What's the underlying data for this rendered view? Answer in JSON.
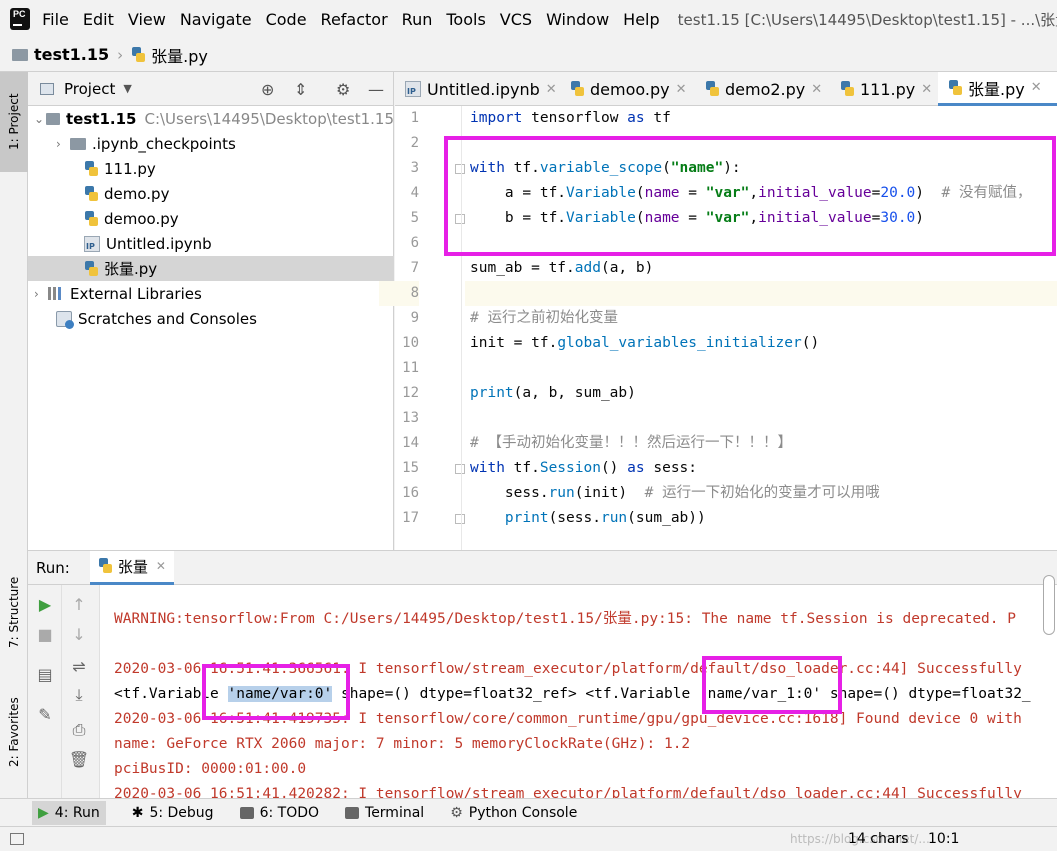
{
  "menu": {
    "items": [
      "File",
      "Edit",
      "View",
      "Navigate",
      "Code",
      "Refactor",
      "Run",
      "Tools",
      "VCS",
      "Window",
      "Help"
    ],
    "window_title": "test1.15 [C:\\Users\\14495\\Desktop\\test1.15] - ...\\张量.py"
  },
  "breadcrumb": {
    "project": "test1.15",
    "file": "张量.py"
  },
  "side_tabs": {
    "project": "1: Project",
    "structure": "7: Structure",
    "favorites": "2: Favorites"
  },
  "project_panel": {
    "title": "Project",
    "tree": [
      {
        "label": "test1.15",
        "path": "C:\\Users\\14495\\Desktop\\test1.15",
        "type": "root"
      },
      {
        "label": ".ipynb_checkpoints",
        "type": "folder"
      },
      {
        "label": "111.py",
        "type": "py"
      },
      {
        "label": "demo.py",
        "type": "py"
      },
      {
        "label": "demoo.py",
        "type": "py"
      },
      {
        "label": "Untitled.ipynb",
        "type": "ipynb"
      },
      {
        "label": "张量.py",
        "type": "py",
        "selected": true
      },
      {
        "label": "External Libraries",
        "type": "lib"
      },
      {
        "label": "Scratches and Consoles",
        "type": "scratch"
      }
    ]
  },
  "editor": {
    "tabs": [
      "Untitled.ipynb",
      "demoo.py",
      "demo2.py",
      "111.py",
      "张量.py"
    ],
    "active_tab": "张量.py",
    "line_numbers": [
      "1",
      "2",
      "3",
      "4",
      "5",
      "6",
      "7",
      "8",
      "9",
      "10",
      "11",
      "12",
      "13",
      "14",
      "15",
      "16",
      "17"
    ],
    "code": {
      "l1_kw": "import",
      "l1_rest": " tensorflow ",
      "l1_kw2": "as",
      "l1_rest2": " tf",
      "l3_kw": "with",
      "l3_a": " tf.",
      "l3_fn": "variable_scope",
      "l3_b": "(",
      "l3_str": "\"name\"",
      "l3_c": "):",
      "l4_a": "    a = tf.",
      "l4_fn": "Variable",
      "l4_b": "(",
      "l4_p1": "name",
      "l4_eq": " = ",
      "l4_str": "\"var\"",
      "l4_comma": ",",
      "l4_p2": "initial_value",
      "l4_eq2": "=",
      "l4_num": "20.0",
      "l4_c": ")  ",
      "l4_cm": "# 没有赋值，",
      "l5_a": "    b = tf.",
      "l5_fn": "Variable",
      "l5_b": "(",
      "l5_p1": "name",
      "l5_eq": " = ",
      "l5_str": "\"var\"",
      "l5_comma": ",",
      "l5_p2": "initial_value",
      "l5_eq2": "=",
      "l5_num": "30.0",
      "l5_c": ")",
      "l7_a": "sum_ab = tf.",
      "l7_fn": "add",
      "l7_b": "(a, b)",
      "l9_cm": "# 运行之前初始化变量",
      "l10_a": "init = tf.",
      "l10_fn": "global_variables_initializer",
      "l10_b": "()",
      "l12_fn": "print",
      "l12_b": "(a, b, sum_ab)",
      "l14_cm": "# 【手动初始化变量！！！然后运行一下！！！】",
      "l15_kw": "with",
      "l15_a": " tf.",
      "l15_fn": "Session",
      "l15_b": "() ",
      "l15_kw2": "as",
      "l15_c": " sess:",
      "l16_a": "    sess.",
      "l16_fn": "run",
      "l16_b": "(init)  ",
      "l16_cm": "# 运行一下初始化的变量才可以用哦",
      "l17_a": "    ",
      "l17_fn": "print",
      "l17_b": "(sess.",
      "l17_fn2": "run",
      "l17_c": "(sum_ab))"
    }
  },
  "run_panel": {
    "label": "Run:",
    "tab": "张量",
    "output": {
      "warning": "WARNING:tensorflow:From C:/Users/14495/Desktop/test1.15/张量.py:15: The name tf.Session is deprecated. P",
      "l2": "2020-03-06 16:51:41.366561: I tensorflow/stream_executor/platform/default/dso_loader.cc:44] Successfully",
      "l3_a": "<tf.Variable ",
      "l3_sel": "'name/var:0'",
      "l3_b": " shape=() dtype=float32_ref> <tf.Variable ",
      "l3_c": "'name/var_1:0'",
      "l3_d": " shape=() dtype=float32_",
      "l4": "2020-03-06 16:51:41.419735: I tensorflow/core/common_runtime/gpu/gpu_device.cc:1618] Found device 0 with",
      "l5": "name: GeForce RTX 2060 major: 7 minor: 5 memoryClockRate(GHz): 1.2",
      "l6": "pciBusID: 0000:01:00.0",
      "l7": "2020-03-06 16:51:41.420282: I tensorflow/stream_executor/platform/default/dso_loader.cc:44] Successfully"
    }
  },
  "bottom_tabs": [
    "4: Run",
    "5: Debug",
    "6: TODO",
    "Terminal",
    "Python Console"
  ],
  "status": {
    "chars": "14 chars",
    "pos": "10:1",
    "watermark": "https://blog.csdn.net/..."
  },
  "colors": {
    "highlight_box": "#e620e6",
    "keyword": "#0033b3",
    "string": "#067d17",
    "number": "#1750eb"
  }
}
